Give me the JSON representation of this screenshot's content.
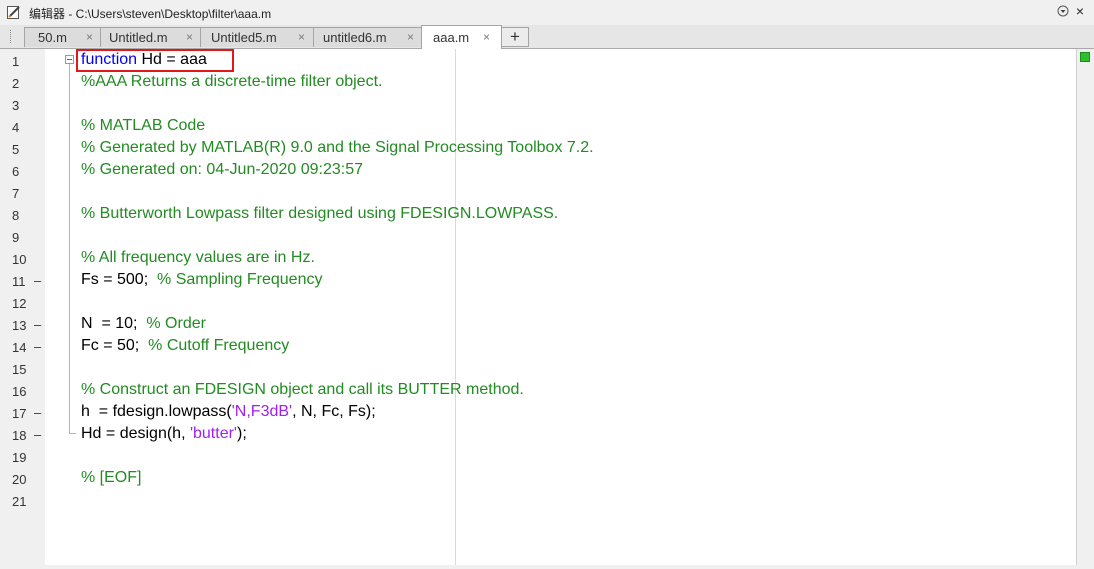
{
  "window": {
    "title": "编辑器 - C:\\Users\\steven\\Desktop\\filter\\aaa.m",
    "pencil_icon": "pencil-icon",
    "menu_icon": "dropdown-circle-icon",
    "close_symbol": "×"
  },
  "tabs": [
    {
      "label": "50.m",
      "close": "×",
      "active": false
    },
    {
      "label": "Untitled.m",
      "close": "×",
      "active": false
    },
    {
      "label": "Untitled5.m",
      "close": "×",
      "active": false
    },
    {
      "label": "untitled6.m",
      "close": "×",
      "active": false
    },
    {
      "label": "aaa.m",
      "close": "×",
      "active": true
    }
  ],
  "add_tab_label": "+",
  "colors": {
    "keyword": "#0000ff",
    "comment": "#228b22",
    "string": "#a020f0",
    "highlight_box": "#e01818",
    "status_ok": "#2ec12e"
  },
  "lines": [
    {
      "num": "1",
      "dash": "",
      "tokens": [
        {
          "t": "function",
          "c": "kw"
        },
        {
          "t": " Hd = aaa",
          "c": "n"
        }
      ]
    },
    {
      "num": "2",
      "dash": "",
      "tokens": [
        {
          "t": "%AAA Returns a discrete-time filter object.",
          "c": "cm"
        }
      ]
    },
    {
      "num": "3",
      "dash": "",
      "tokens": []
    },
    {
      "num": "4",
      "dash": "",
      "tokens": [
        {
          "t": "% MATLAB Code",
          "c": "cm"
        }
      ]
    },
    {
      "num": "5",
      "dash": "",
      "tokens": [
        {
          "t": "% Generated by MATLAB(R) 9.0 and the Signal Processing Toolbox 7.2.",
          "c": "cm"
        }
      ]
    },
    {
      "num": "6",
      "dash": "",
      "tokens": [
        {
          "t": "% Generated on: 04-Jun-2020 09:23:57",
          "c": "cm"
        }
      ]
    },
    {
      "num": "7",
      "dash": "",
      "tokens": []
    },
    {
      "num": "8",
      "dash": "",
      "tokens": [
        {
          "t": "% Butterworth Lowpass filter designed using FDESIGN.LOWPASS.",
          "c": "cm"
        }
      ]
    },
    {
      "num": "9",
      "dash": "",
      "tokens": []
    },
    {
      "num": "10",
      "dash": "",
      "tokens": [
        {
          "t": "% All frequency values are in Hz.",
          "c": "cm"
        }
      ]
    },
    {
      "num": "11",
      "dash": "–",
      "tokens": [
        {
          "t": "Fs = 500;  ",
          "c": "n"
        },
        {
          "t": "% Sampling Frequency",
          "c": "cm"
        }
      ]
    },
    {
      "num": "12",
      "dash": "",
      "tokens": []
    },
    {
      "num": "13",
      "dash": "–",
      "tokens": [
        {
          "t": "N  = 10;  ",
          "c": "n"
        },
        {
          "t": "% Order",
          "c": "cm"
        }
      ]
    },
    {
      "num": "14",
      "dash": "–",
      "tokens": [
        {
          "t": "Fc = 50;  ",
          "c": "n"
        },
        {
          "t": "% Cutoff Frequency",
          "c": "cm"
        }
      ]
    },
    {
      "num": "15",
      "dash": "",
      "tokens": []
    },
    {
      "num": "16",
      "dash": "",
      "tokens": [
        {
          "t": "% Construct an FDESIGN object and call its BUTTER method.",
          "c": "cm"
        }
      ]
    },
    {
      "num": "17",
      "dash": "–",
      "tokens": [
        {
          "t": "h  = fdesign.lowpass(",
          "c": "n"
        },
        {
          "t": "'N,F3dB'",
          "c": "st"
        },
        {
          "t": ", N, Fc, Fs);",
          "c": "n"
        }
      ]
    },
    {
      "num": "18",
      "dash": "–",
      "tokens": [
        {
          "t": "Hd = design(h, ",
          "c": "n"
        },
        {
          "t": "'butter'",
          "c": "st"
        },
        {
          "t": ");",
          "c": "n"
        }
      ]
    },
    {
      "num": "19",
      "dash": "",
      "tokens": []
    },
    {
      "num": "20",
      "dash": "",
      "tokens": [
        {
          "t": "% [EOF]",
          "c": "cm"
        }
      ]
    },
    {
      "num": "21",
      "dash": "",
      "tokens": []
    }
  ]
}
